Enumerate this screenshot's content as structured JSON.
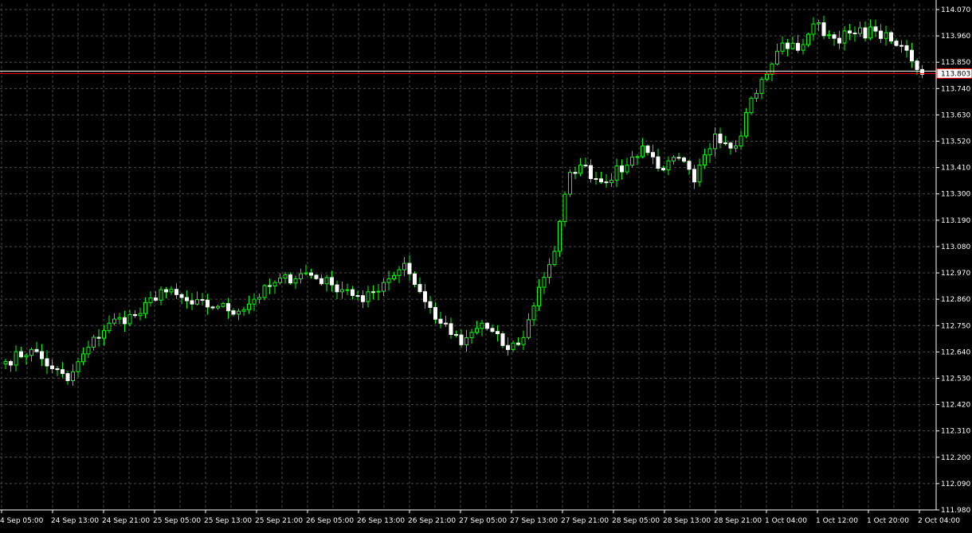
{
  "chart_data": {
    "type": "candlestick",
    "y_tick_labels": [
      "114.070",
      "113.960",
      "113.850",
      "113.740",
      "113.630",
      "113.520",
      "113.410",
      "113.300",
      "113.190",
      "113.080",
      "112.970",
      "112.860",
      "112.750",
      "112.640",
      "112.530",
      "112.420",
      "112.310",
      "112.200",
      "112.090",
      "111.980"
    ],
    "x_tick_labels": [
      "4 Sep 05:00",
      "24 Sep 13:00",
      "24 Sep 21:00",
      "25 Sep 05:00",
      "25 Sep 13:00",
      "25 Sep 21:00",
      "26 Sep 05:00",
      "26 Sep 13:00",
      "26 Sep 21:00",
      "27 Sep 05:00",
      "27 Sep 13:00",
      "27 Sep 21:00",
      "28 Sep 05:00",
      "28 Sep 13:00",
      "28 Sep 21:00",
      "1 Oct 04:00",
      "1 Oct 12:00",
      "1 Oct 20:00",
      "2 Oct 04:00"
    ],
    "ylim": [
      111.98,
      114.07
    ],
    "grid": true,
    "current_price": "113.803",
    "current_price_value": 113.803,
    "colors": {
      "background": "#000000",
      "bull": "#00ff00",
      "bear": "#ffffff",
      "grid": "#4a4a4a",
      "price_line": "#ff0000"
    },
    "close_keypoints": [
      [
        0,
        112.6
      ],
      [
        5,
        112.65
      ],
      [
        9,
        112.57
      ],
      [
        12,
        112.52
      ],
      [
        16,
        112.66
      ],
      [
        20,
        112.76
      ],
      [
        26,
        112.8
      ],
      [
        30,
        112.9
      ],
      [
        36,
        112.84
      ],
      [
        41,
        112.83
      ],
      [
        45,
        112.81
      ],
      [
        48,
        112.86
      ],
      [
        52,
        112.93
      ],
      [
        58,
        112.97
      ],
      [
        63,
        112.92
      ],
      [
        66,
        112.9
      ],
      [
        69,
        112.85
      ],
      [
        73,
        112.93
      ],
      [
        77,
        113.01
      ],
      [
        81,
        112.85
      ],
      [
        84,
        112.76
      ],
      [
        88,
        112.67
      ],
      [
        92,
        112.76
      ],
      [
        97,
        112.65
      ],
      [
        100,
        112.7
      ],
      [
        103,
        112.91
      ],
      [
        106,
        113.06
      ],
      [
        109,
        113.39
      ],
      [
        111,
        113.42
      ],
      [
        115,
        113.35
      ],
      [
        120,
        113.42
      ],
      [
        123,
        113.5
      ],
      [
        127,
        113.4
      ],
      [
        130,
        113.45
      ],
      [
        133,
        113.35
      ],
      [
        137,
        113.55
      ],
      [
        141,
        113.5
      ],
      [
        144,
        113.7
      ],
      [
        147,
        113.8
      ],
      [
        150,
        113.93
      ],
      [
        153,
        113.9
      ],
      [
        156,
        114.01
      ],
      [
        160,
        113.95
      ],
      [
        164,
        113.97
      ],
      [
        168,
        113.98
      ],
      [
        172,
        113.92
      ],
      [
        174,
        113.9
      ],
      [
        177,
        113.8
      ]
    ]
  }
}
